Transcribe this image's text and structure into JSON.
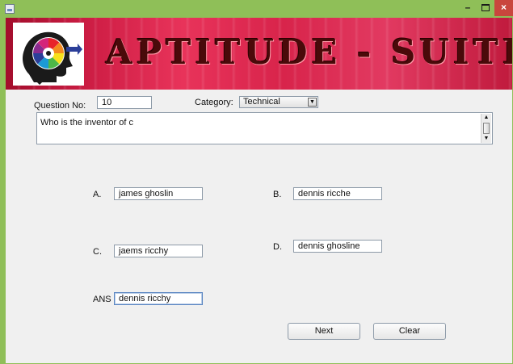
{
  "window": {
    "minimize_glyph": "–",
    "close_glyph": "×"
  },
  "banner": {
    "title": "APTITUDE - SUITE"
  },
  "form": {
    "question_no_label": "Question No:",
    "question_no_value": "10",
    "category_label": "Category:",
    "category_value": "Technical",
    "question_text": "Who is the inventor of c",
    "option_a_label": "A.",
    "option_a_value": "james ghoslin",
    "option_b_label": "B.",
    "option_b_value": "dennis ricche",
    "option_c_label": "C.",
    "option_c_value": "jaems ricchy",
    "option_d_label": "D.",
    "option_d_value": "dennis ghosline",
    "answer_label": "ANS",
    "answer_value": "dennis ricchy"
  },
  "buttons": {
    "next_label": "Next",
    "clear_label": "Clear"
  },
  "icons": {
    "app": "java-app-icon",
    "logo": "head-gear-logo-icon",
    "combo_arrow": "chevron-down-icon"
  }
}
